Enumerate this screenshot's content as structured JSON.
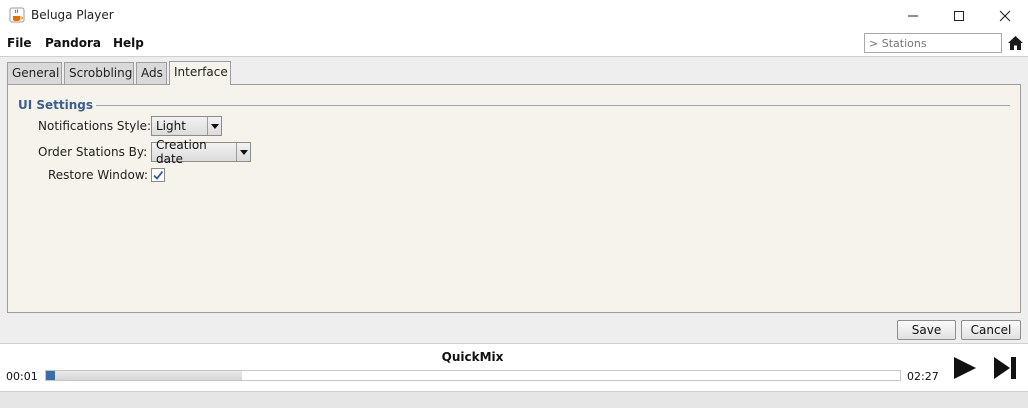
{
  "window": {
    "title": "Beluga Player",
    "icons": {
      "app": "java-cup-icon",
      "minimize": "minimize-icon",
      "maximize": "maximize-icon",
      "close": "close-icon"
    }
  },
  "menu": {
    "items": [
      "File",
      "Pandora",
      "Help"
    ]
  },
  "search": {
    "placeholder": "> Stations",
    "value": ""
  },
  "tabs": [
    {
      "label": "General",
      "active": false
    },
    {
      "label": "Scrobbling",
      "active": false
    },
    {
      "label": "Ads",
      "active": false
    },
    {
      "label": "Interface",
      "active": true
    }
  ],
  "settings": {
    "section_title": "UI Settings",
    "notifications_label": "Notifications Style:",
    "notifications_value": "Light",
    "order_label": "Order Stations By:",
    "order_value": "Creation date",
    "restore_label": "Restore Window:",
    "restore_checked": true
  },
  "buttons": {
    "save": "Save",
    "cancel": "Cancel"
  },
  "player": {
    "song": "QuickMix",
    "elapsed": "00:01",
    "total": "02:27",
    "progress_fraction": 0.01,
    "buffered_fraction": 0.23
  },
  "colors": {
    "accent": "#3a6ea5",
    "section_title": "#3a5e8f",
    "panel_bg": "#f6f3ec"
  }
}
